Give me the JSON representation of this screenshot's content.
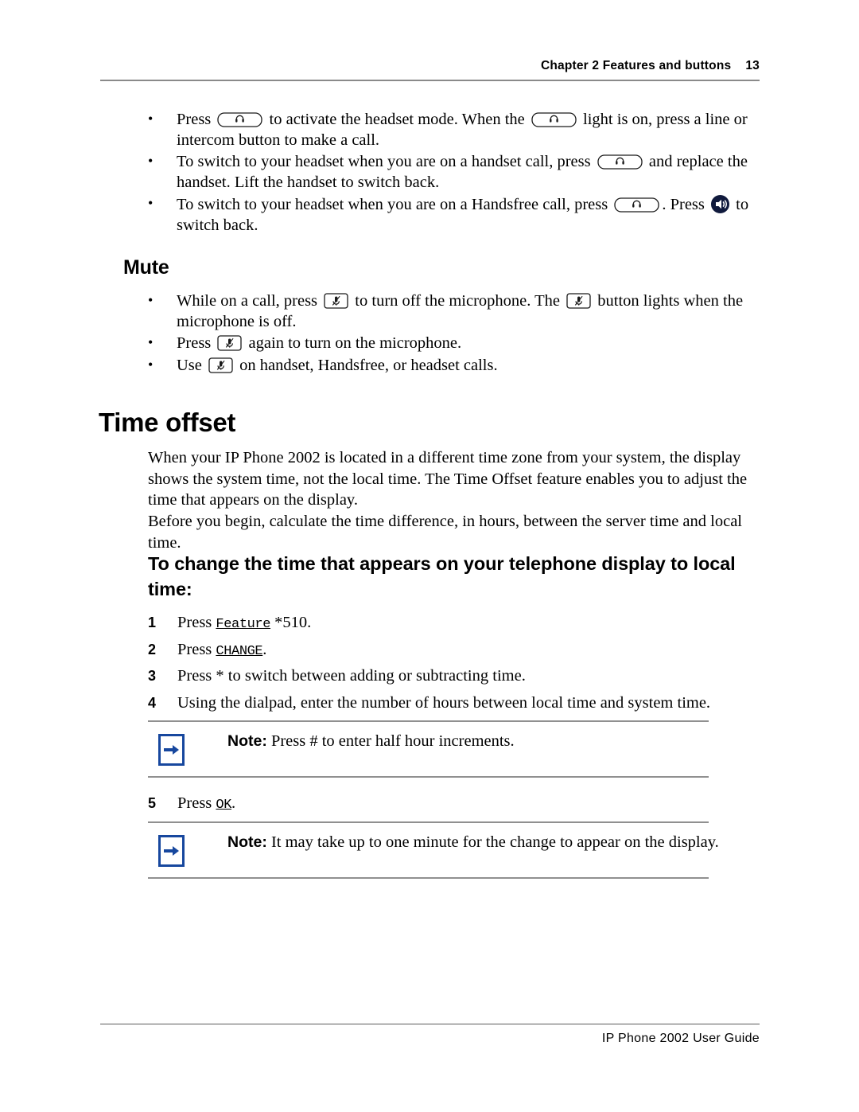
{
  "header": {
    "chapter": "Chapter 2  Features and buttons",
    "page_number": "13"
  },
  "footer": {
    "guide_title": "IP Phone 2002 User Guide"
  },
  "headset_bullets": [
    {
      "part1": "Press",
      "icon1": "headset-key-icon",
      "part2": "to activate the headset mode. When the",
      "icon2": "headset-key-icon",
      "part3": "light is on, press a line or intercom button to make a call."
    },
    {
      "part1": "To switch to your headset when you are on a handset call, press",
      "icon1": "headset-key-icon",
      "part2": "and replace the handset. Lift the handset to switch back."
    },
    {
      "part1": "To switch to your headset when you are on a Handsfree call, press",
      "icon1": "headset-key-icon",
      "part2": ". Press",
      "icon2": "handsfree-speaker-icon",
      "part3": "to switch back."
    }
  ],
  "mute": {
    "heading": "Mute",
    "bullets": [
      {
        "part1": "While on a call, press",
        "icon1": "mute-key-icon",
        "part2": "to turn off the microphone. The",
        "icon2": "mute-key-icon",
        "part3": "button lights when the microphone is off."
      },
      {
        "part1": "Press",
        "icon1": "mute-key-icon",
        "part2": "again to turn on the microphone."
      },
      {
        "part1": "Use",
        "icon1": "mute-key-icon",
        "part2": "on handset, Handsfree, or headset calls."
      }
    ]
  },
  "time_offset": {
    "heading": "Time offset",
    "paragraph1": "When your IP Phone 2002 is located in a different time zone from your system, the display shows the system time, not the local time. The Time Offset feature enables you to adjust the time that appears on the display.",
    "paragraph2": "Before you begin, calculate the time difference, in hours, between the server time and local time.",
    "procedure_heading": "To change the time that appears on your telephone display to local time:",
    "steps": [
      {
        "num": "1",
        "pre": "Press ",
        "key": "Feature",
        "post": " *510."
      },
      {
        "num": "2",
        "pre": "Press ",
        "key": "CHANGE",
        "post": "."
      },
      {
        "num": "3",
        "pre": "Press * to switch between adding or subtracting time.",
        "key": "",
        "post": ""
      },
      {
        "num": "4",
        "pre": "Using the dialpad, enter the number of hours between local time and system time.",
        "key": "",
        "post": ""
      },
      {
        "num": "5",
        "pre": "Press ",
        "key": "OK",
        "post": "."
      }
    ],
    "notes": [
      {
        "label": "Note:",
        "text": " Press # to enter half hour increments.",
        "icon": "blue-arrow-icon"
      },
      {
        "label": "Note:",
        "text": " It may take up to one minute for the change to appear on the display.",
        "icon": "blue-arrow-icon"
      }
    ]
  },
  "colors": {
    "note_blue": "#17479e",
    "rule_gray": "#909090",
    "text_black": "#000000"
  }
}
